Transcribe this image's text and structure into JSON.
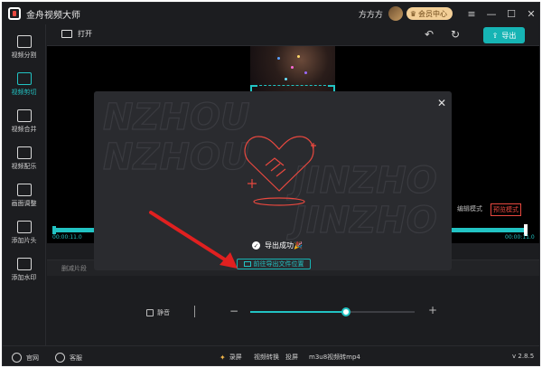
{
  "app": {
    "title": "金舟视频大师",
    "user": "方方方",
    "vip_label": "会员中心",
    "version": "v 2.8.5"
  },
  "sidebar": {
    "items": [
      {
        "label": "视频分割",
        "icon": "split-icon"
      },
      {
        "label": "视频剪切",
        "icon": "scissors-icon"
      },
      {
        "label": "视频合并",
        "icon": "merge-icon"
      },
      {
        "label": "视频配乐",
        "icon": "music-icon"
      },
      {
        "label": "画面调整",
        "icon": "adjust-icon"
      },
      {
        "label": "添加片头",
        "icon": "add-intro-icon"
      },
      {
        "label": "添加水印",
        "icon": "watermark-icon"
      }
    ],
    "active": "视频剪切"
  },
  "toolbar": {
    "open_label": "打开",
    "export_label": "导出"
  },
  "preview": {
    "mode_edit": "编辑模式",
    "mode_preview": "预览模式",
    "time_start": "00:00:11.0",
    "time_end": "00:00:11.0"
  },
  "editor": {
    "clip_tab": "删减片段",
    "mute_label": "静音",
    "volume_level": 0.58
  },
  "modal": {
    "success_text": "导出成功🎉",
    "goto_label": "前往导出文件位置"
  },
  "statusbar": {
    "website": "官网",
    "support": "客服",
    "tools": [
      "录屏",
      "视频转换",
      "投屏",
      "m3u8视频转mp4"
    ]
  },
  "colors": {
    "accent": "#16b4b4",
    "danger": "#e8483f",
    "vip": "#f3cf97"
  }
}
